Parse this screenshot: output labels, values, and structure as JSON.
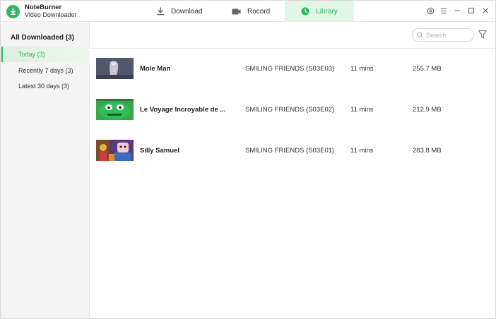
{
  "app": {
    "name": "NoteBurner",
    "subtitle": "Video Downloader"
  },
  "tabs": [
    {
      "label": "Download",
      "icon": "download-icon"
    },
    {
      "label": "Rocord",
      "icon": "record-camera-icon"
    },
    {
      "label": "Library",
      "icon": "clock-icon",
      "active": true
    }
  ],
  "sidebar": {
    "heading": "All Downloaded (3)",
    "items": [
      {
        "label": "Today (3)",
        "active": true
      },
      {
        "label": "Recently 7 days (3)"
      },
      {
        "label": "Latest 30 days (3)"
      }
    ]
  },
  "search": {
    "placeholder": "Search"
  },
  "videos": [
    {
      "title": "Mole Man",
      "series": "SMILING FRIENDS (S03E03)",
      "duration": "11 mins",
      "size": "255.7 MB"
    },
    {
      "title": "Le Voyage Incroyable de ...",
      "series": "SMILING FRIENDS (S03E02)",
      "duration": "11 mins",
      "size": "212.9 MB"
    },
    {
      "title": "Silly Samuel",
      "series": "SMILING FRIENDS (S03E01)",
      "duration": "11 mins",
      "size": "283.8 MB"
    }
  ],
  "colors": {
    "accent": "#2fb85f",
    "active_tab_bg": "#e3f5e6",
    "sidebar_bg": "#f4f4f4"
  }
}
